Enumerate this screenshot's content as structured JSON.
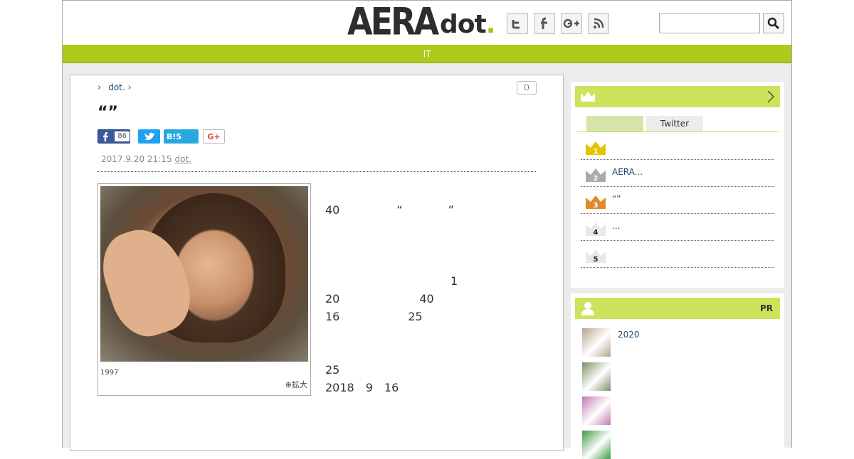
{
  "header": {
    "logo_main": "AERA",
    "logo_dot": "dot",
    "logo_dotmark": ".",
    "social": [
      {
        "icon": "twitter-icon",
        "glyph": "t"
      },
      {
        "icon": "facebook-icon",
        "glyph": "f"
      },
      {
        "icon": "googleplus-icon",
        "glyph": "G+"
      },
      {
        "icon": "rss-icon",
        "glyph": "rss"
      }
    ],
    "search_placeholder": ""
  },
  "nav": {
    "label": "IT"
  },
  "article": {
    "breadcrumb": [
      "dot."
    ],
    "comment_count": "()",
    "title": "“”",
    "share": {
      "fb_count": "86",
      "hb_label": "B!5",
      "gp_label": "G+"
    },
    "date": "2017.9.20 21:15",
    "source": "dot.",
    "photo_caption": "1997",
    "zoom_label": "拡大",
    "paragraphs": [
      "　　　　　　　　　　　40　　　　　“　　　　”　　　　　　　　　　　　　　　　　",
      "　　　　　　　　　　　　　　　　　　　　　　　　　　　　　　　　　　",
      "　　　　　　　　　　　1　　　　　　　　　　20　　　　　　　40　　　　　　　　16　　　　　　25　　　　　　　　　　　　　　　　",
      "　　　　　　　　　　　　　　　　　　　　　　　　　　　　　　　　　　　25　　　　　　　　　　　　　　　　　　　　　　　　　　　　　　　　　　　　　　　　　　　　　　　　2018　9　16　　　　　　　　　　　　　　　　　　　　　　　　　　　　"
    ],
    "tail": "　　　　　　　　　　　　　　　　　　　　　　　　　　　"
  },
  "ranking": {
    "tabs": [
      "",
      "Twitter"
    ],
    "items": [
      {
        "rank": "1",
        "color": "#e4c400",
        "text": ""
      },
      {
        "rank": "2",
        "color": "#aaaaaa",
        "text": "AERA..."
      },
      {
        "rank": "3",
        "color": "#e08a2e",
        "text": "“”"
      },
      {
        "rank": "4",
        "color": "#e8e8e8",
        "text": "..."
      },
      {
        "rank": "5",
        "color": "#e8e8e8",
        "text": ""
      }
    ]
  },
  "pr": {
    "badge": "PR",
    "items": [
      {
        "text": "2020",
        "color": "#b7a48c"
      },
      {
        "text": "",
        "color": "#7d8f6a"
      },
      {
        "text": "",
        "color": "#c07ab0"
      },
      {
        "text": "",
        "color": "#3d9a43"
      }
    ]
  },
  "colors": {
    "accent": "#adc919",
    "sidebar_head": "#cfe25b",
    "link": "#1a4a7a"
  }
}
